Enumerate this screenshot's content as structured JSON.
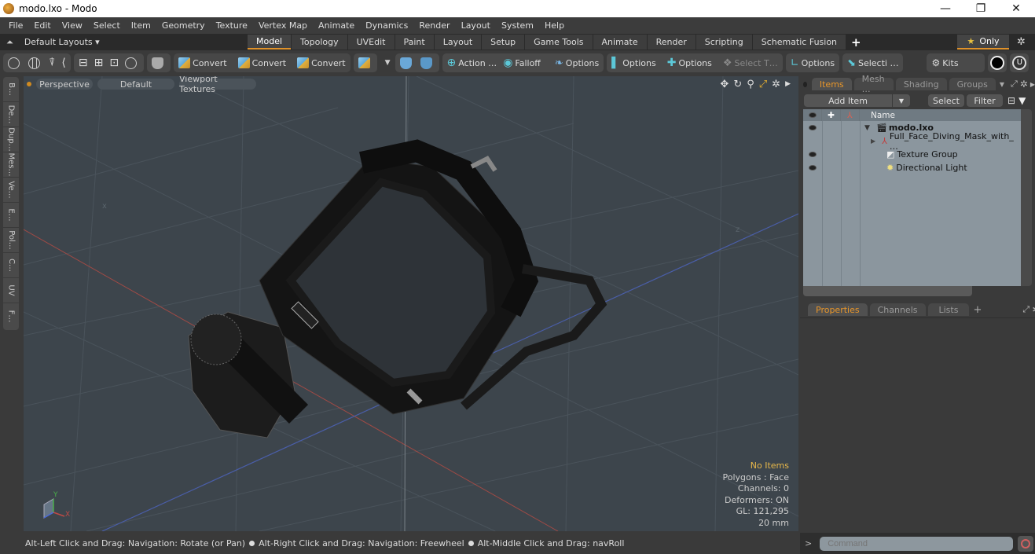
{
  "window": {
    "title": "modo.lxo - Modo",
    "minimize": "—",
    "restore": "❐",
    "close": "✕"
  },
  "menu": [
    "File",
    "Edit",
    "View",
    "Select",
    "Item",
    "Geometry",
    "Texture",
    "Vertex Map",
    "Animate",
    "Dynamics",
    "Render",
    "Layout",
    "System",
    "Help"
  ],
  "layouts": {
    "dropdown": "Default Layouts ▾",
    "tabs": [
      "Model",
      "Topology",
      "UVEdit",
      "Paint",
      "Layout",
      "Setup",
      "Game Tools",
      "Animate",
      "Render",
      "Scripting",
      "Schematic Fusion"
    ],
    "active_tab": "Model",
    "add": "+",
    "only": "Only",
    "accent": "#e0922a"
  },
  "toolbar": {
    "convert1": "Convert",
    "convert2": "Convert",
    "convert3": "Convert",
    "action": "Action …",
    "falloff": "Falloff",
    "options1": "Options",
    "options2": "Options",
    "options3": "Options",
    "select_t": "Select T…",
    "options4": "Options",
    "selecti": "Selecti …",
    "kits": "Kits"
  },
  "left_tabs": [
    "B…",
    "De…",
    "Dup…",
    "Mes…",
    "Ve…",
    "E…",
    "Pol…",
    "C…",
    "UV",
    "F…"
  ],
  "viewport": {
    "view": "Perspective",
    "shading": "Default",
    "textures": "Viewport Textures",
    "info": {
      "selection": "No Items",
      "polygons": "Polygons : Face",
      "channels": "Channels: 0",
      "deformers": "Deformers: ON",
      "gl": "GL: 121,295",
      "scale": "20 mm"
    },
    "axis": {
      "x": "X",
      "y": "Y"
    }
  },
  "status": {
    "hint1": "Alt-Left Click and Drag: Navigation: Rotate (or Pan)",
    "hint2": "Alt-Right Click and Drag: Navigation: Freewheel",
    "hint3": "Alt-Middle Click and Drag: navRoll"
  },
  "items_panel": {
    "tabs": [
      "Items",
      "Mesh …",
      "Shading",
      "Groups"
    ],
    "active_tab": "Items",
    "add_item": "Add Item",
    "select": "Select",
    "filter": "Filter",
    "col_name": "Name",
    "tree": [
      {
        "name": "modo.lxo",
        "visible": true,
        "bold": true
      },
      {
        "name": "Full_Face_Diving_Mask_with_ …",
        "visible": false
      },
      {
        "name": "Texture Group",
        "visible": true
      },
      {
        "name": "Directional Light",
        "visible": true
      }
    ]
  },
  "properties_panel": {
    "tabs": [
      "Properties",
      "Channels",
      "Lists"
    ],
    "active_tab": "Properties",
    "add": "+"
  },
  "command": {
    "prompt": ">",
    "placeholder": "Command"
  }
}
